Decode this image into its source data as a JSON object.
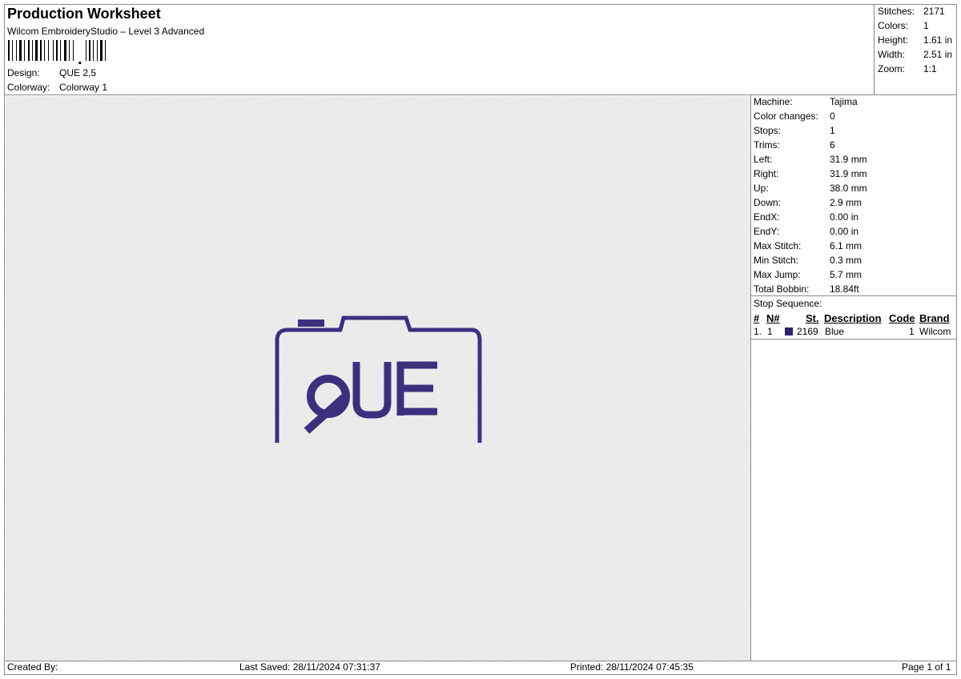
{
  "header": {
    "title": "Production Worksheet",
    "software": "Wilcom EmbroideryStudio – Level 3 Advanced",
    "design_label": "Design:",
    "design_value": "QUE 2,5",
    "colorway_label": "Colorway:",
    "colorway_value": "Colorway 1"
  },
  "summary": [
    {
      "label": "Stitches:",
      "value": "2171"
    },
    {
      "label": "Colors:",
      "value": "1"
    },
    {
      "label": "Height:",
      "value": "1.61 in"
    },
    {
      "label": "Width:",
      "value": "2.51 in"
    },
    {
      "label": "Zoom:",
      "value": "1:1"
    }
  ],
  "machine_info": [
    {
      "label": "Machine:",
      "value": "Tajima"
    },
    {
      "label": "Color changes:",
      "value": "0"
    },
    {
      "label": "Stops:",
      "value": "1"
    },
    {
      "label": "Trims:",
      "value": "6"
    },
    {
      "label": "Left:",
      "value": "31.9 mm"
    },
    {
      "label": "Right:",
      "value": "31.9 mm"
    },
    {
      "label": "Up:",
      "value": "38.0 mm"
    },
    {
      "label": "Down:",
      "value": "2.9 mm"
    },
    {
      "label": "EndX:",
      "value": "0.00 in"
    },
    {
      "label": "EndY:",
      "value": "0.00 in"
    },
    {
      "label": "Max Stitch:",
      "value": "6.1 mm"
    },
    {
      "label": "Min Stitch:",
      "value": "0.3 mm"
    },
    {
      "label": "Max Jump:",
      "value": "5.7 mm"
    },
    {
      "label": "Total Bobbin:",
      "value": "18.84ft"
    }
  ],
  "stop_sequence": {
    "title": "Stop Sequence:",
    "headers": {
      "num": "#",
      "n": "N#",
      "st": "St.",
      "description": "Description",
      "code": "Code",
      "brand": "Brand"
    },
    "rows": [
      {
        "num": "1.",
        "n": "1",
        "swatch": "#2a2370",
        "st": "2169",
        "description": "Blue",
        "code": "1",
        "brand": "Wilcom"
      }
    ]
  },
  "design_preview": {
    "thread_color": "#3d2f7e",
    "text": "QUE"
  },
  "footer": {
    "created_by": "Created By:",
    "last_saved": "Last Saved: 28/11/2024 07:31:37",
    "printed": "Printed: 28/11/2024 07:45:35",
    "page": "Page 1 of 1"
  }
}
